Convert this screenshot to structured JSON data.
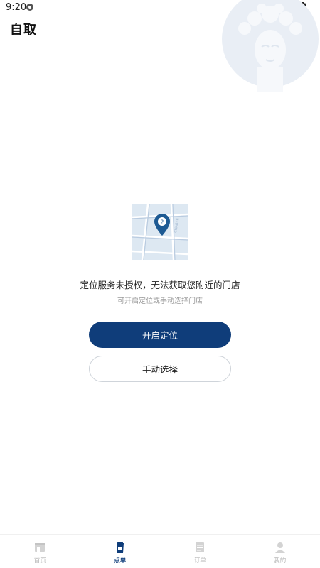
{
  "status": {
    "time": "9:20"
  },
  "header": {
    "title": "自取"
  },
  "empty_state": {
    "title": "定位服务未授权，无法获取您附近的门店",
    "subtitle": "可开启定位或手动选择门店",
    "map_text": "CHAGEE"
  },
  "actions": {
    "enable_location": "开启定位",
    "manual_select": "手动选择"
  },
  "tabs": [
    {
      "label": "首页",
      "icon": "home-icon",
      "active": false
    },
    {
      "label": "点单",
      "icon": "cup-icon",
      "active": true
    },
    {
      "label": "订单",
      "icon": "receipt-icon",
      "active": false
    },
    {
      "label": "我的",
      "icon": "person-icon",
      "active": false
    }
  ],
  "colors": {
    "primary": "#0f3d7a",
    "map_bg": "#dde8f2",
    "inactive": "#b5b5b5"
  }
}
